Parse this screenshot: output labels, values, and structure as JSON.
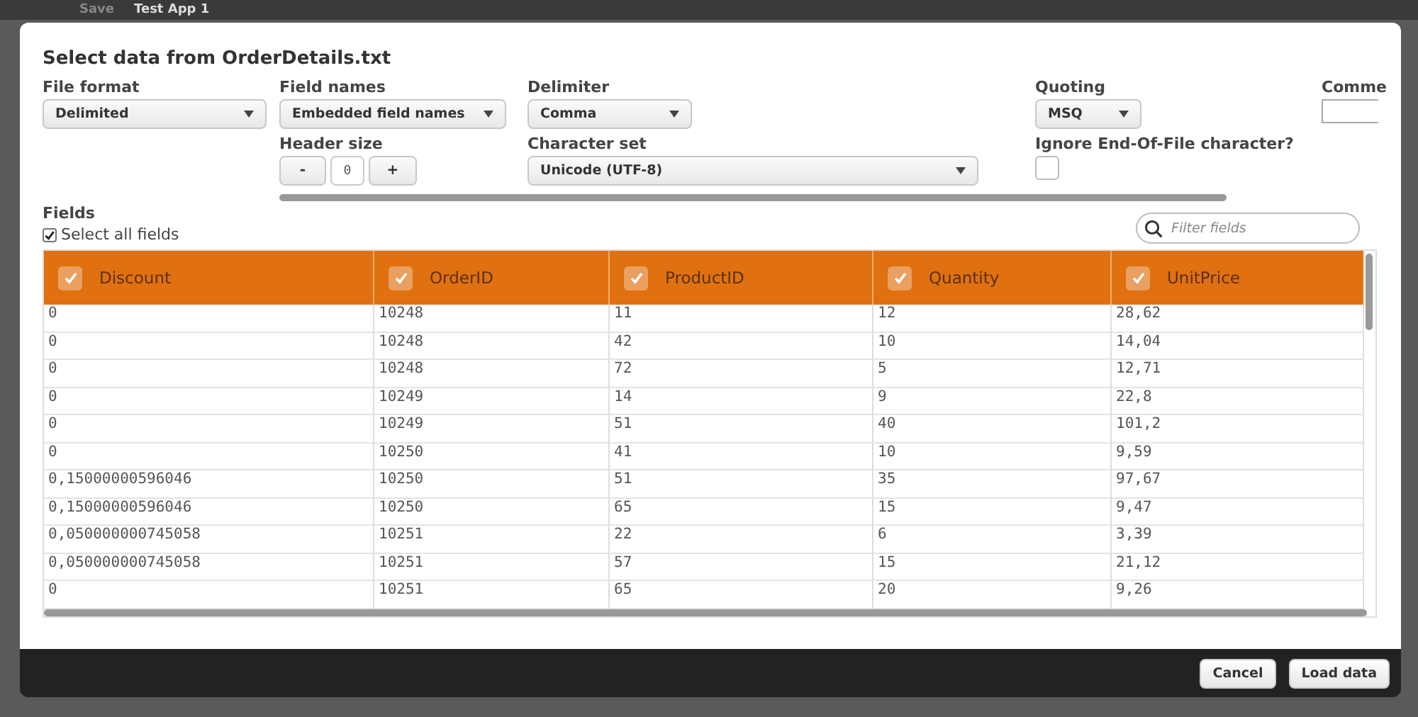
{
  "app_bar": {
    "save": "Save",
    "app_title": "Test App 1"
  },
  "dialog": {
    "title": "Select data from OrderDetails.txt"
  },
  "form": {
    "file_format": {
      "label": "File format",
      "value": "Delimited"
    },
    "field_names": {
      "label": "Field names",
      "value": "Embedded field names"
    },
    "delimiter": {
      "label": "Delimiter",
      "value": "Comma"
    },
    "quoting": {
      "label": "Quoting",
      "value": "MSQ"
    },
    "comment": {
      "label": "Comme"
    },
    "header_size": {
      "label": "Header size",
      "minus": "-",
      "value": "0",
      "plus": "+"
    },
    "character_set": {
      "label": "Character set",
      "value": "Unicode (UTF-8)"
    },
    "ignore_eof": {
      "label": "Ignore End-Of-File character?",
      "checked": false
    }
  },
  "fields": {
    "label": "Fields",
    "select_all": {
      "label": "Select all fields",
      "checked": true
    },
    "filter": {
      "placeholder": "Filter fields"
    }
  },
  "table": {
    "columns": [
      {
        "name": "Discount",
        "checked": true
      },
      {
        "name": "OrderID",
        "checked": true
      },
      {
        "name": "ProductID",
        "checked": true
      },
      {
        "name": "Quantity",
        "checked": true
      },
      {
        "name": "UnitPrice",
        "checked": true
      }
    ],
    "rows": [
      [
        "0",
        "10248",
        "11",
        "12",
        "28,62"
      ],
      [
        "0",
        "10248",
        "42",
        "10",
        "14,04"
      ],
      [
        "0",
        "10248",
        "72",
        "5",
        "12,71"
      ],
      [
        "0",
        "10249",
        "14",
        "9",
        "22,8"
      ],
      [
        "0",
        "10249",
        "51",
        "40",
        "101,2"
      ],
      [
        "0",
        "10250",
        "41",
        "10",
        "9,59"
      ],
      [
        "0,15000000596046",
        "10250",
        "51",
        "35",
        "97,67"
      ],
      [
        "0,15000000596046",
        "10250",
        "65",
        "15",
        "9,47"
      ],
      [
        "0,050000000745058",
        "10251",
        "22",
        "6",
        "3,39"
      ],
      [
        "0,050000000745058",
        "10251",
        "57",
        "15",
        "21,12"
      ],
      [
        "0",
        "10251",
        "65",
        "20",
        "9,26"
      ]
    ]
  },
  "buttons": [
    "Cancel",
    "Load data"
  ]
}
